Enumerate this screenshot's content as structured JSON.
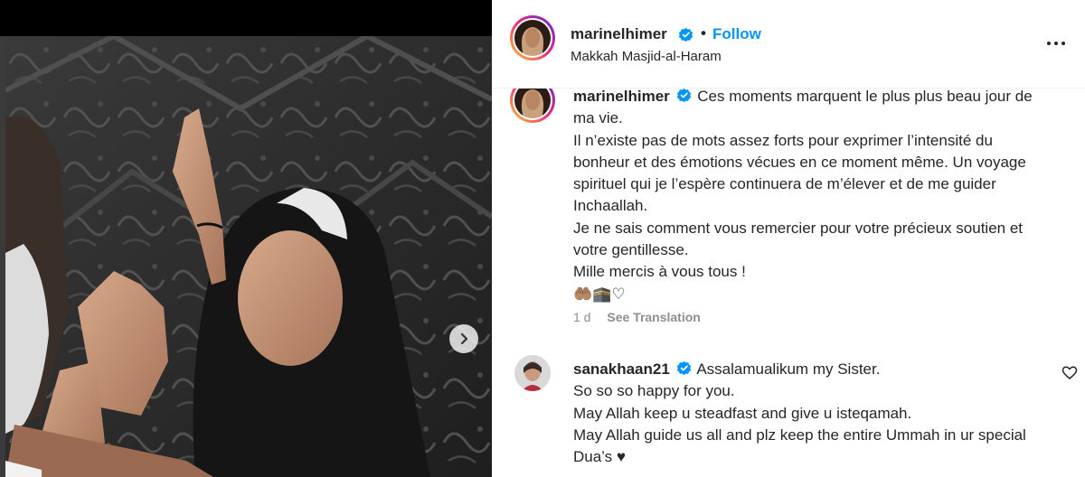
{
  "post": {
    "username": "marinelhimer",
    "follow_label": "Follow",
    "separator": "•",
    "location": "Makkah Masjid-al-Haram",
    "more_icon": "more-options-icon"
  },
  "caption": {
    "username": "marinelhimer",
    "lines": [
      "Ces moments marquent le plus plus beau jour de ma vie.",
      "Il n’existe pas de mots assez forts pour exprimer l’intensité du bonheur et des émotions vécues en ce moment même. Un voyage spirituel qui je l’espère continuera de m’élever et de me guider Inchaallah.",
      "Je ne sais comment vous remercier pour votre précieux soutien et votre gentillesse.",
      "Mille mercis à vous tous !"
    ],
    "emoji_line": "🤲🏽🕋♡",
    "time": "1 d",
    "see_translation": "See Translation"
  },
  "comment": {
    "username": "sanakhaan21",
    "lines": [
      "Assalamualikum my Sister.",
      "So so so happy for you.",
      "May Allah keep u steadfast and give u isteqamah.",
      "May Allah guide us all and plz keep the entire Ummah in ur special Dua’s ♥"
    ]
  },
  "colors": {
    "accent": "#0095f6",
    "text": "#262626",
    "muted": "#8e8e8e",
    "verified": "#0095f6"
  }
}
